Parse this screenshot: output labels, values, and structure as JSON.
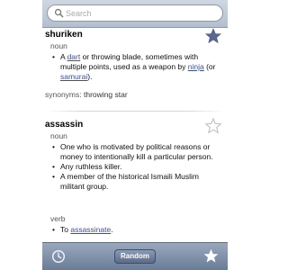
{
  "search": {
    "placeholder": "Search"
  },
  "entries": [
    {
      "word": "shuriken",
      "favorited": true,
      "pos": "noun",
      "definition": {
        "t1": "A ",
        "link1": "dart",
        "t2": " or throwing blade, sometimes with multiple points, used as a weapon by ",
        "link2": "ninja",
        "t3": " (or ",
        "link3": "samurai",
        "t4": ")."
      },
      "synonyms_label": "synonyms:",
      "synonyms": "throwing star"
    },
    {
      "word": "assassin",
      "favorited": false,
      "pos1": "noun",
      "noun_defs": [
        "One who is motivated by political reasons or money to intentionally kill a particular person.",
        "Any ruthless killer.",
        "A member of the historical Ismaili Muslim militant group."
      ],
      "pos2": "verb",
      "verb_def": {
        "t1": "To ",
        "link": "assassinate",
        "t2": "."
      }
    }
  ],
  "toolbar": {
    "random_label": "Random"
  },
  "icons": {
    "search": "magnifier-icon",
    "star_filled": "star-filled-icon",
    "star_empty": "star-outline-icon",
    "history": "clock-icon",
    "favorites": "star-icon"
  },
  "colors": {
    "star_filled": "#5c6690",
    "link": "#3b4ea0",
    "toolbar": "#7b8ca6"
  }
}
